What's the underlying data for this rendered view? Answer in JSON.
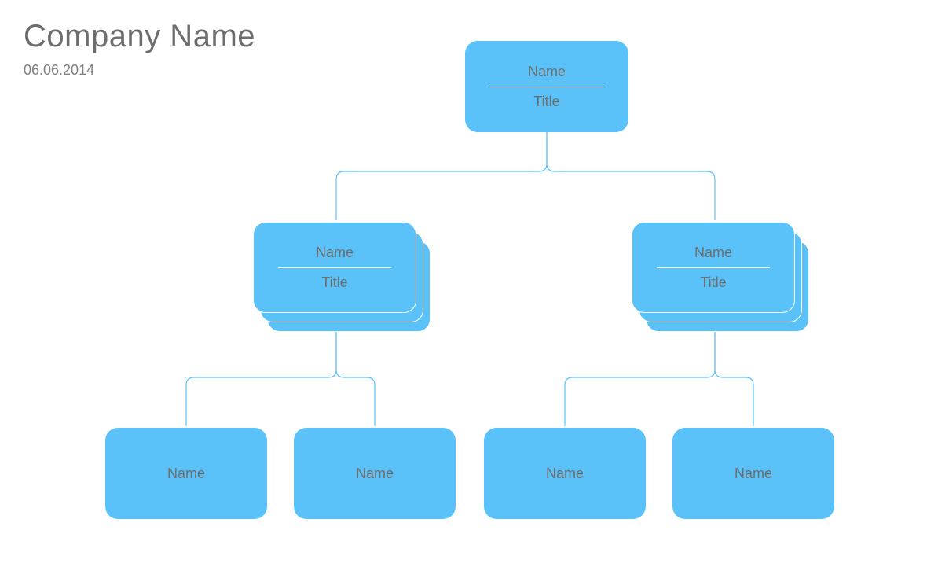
{
  "header": {
    "company_name": "Company Name",
    "date": "06.06.2014"
  },
  "colors": {
    "node_fill": "#5BC2F9",
    "text": "#6d6d6d",
    "divider": "#ffffff"
  },
  "org": {
    "root": {
      "name": "Name",
      "title": "Title",
      "children": [
        {
          "name": "Name",
          "title": "Title",
          "stacked": true,
          "children": [
            {
              "name": "Name"
            },
            {
              "name": "Name"
            }
          ]
        },
        {
          "name": "Name",
          "title": "Title",
          "stacked": true,
          "children": [
            {
              "name": "Name"
            },
            {
              "name": "Name"
            }
          ]
        }
      ]
    }
  }
}
